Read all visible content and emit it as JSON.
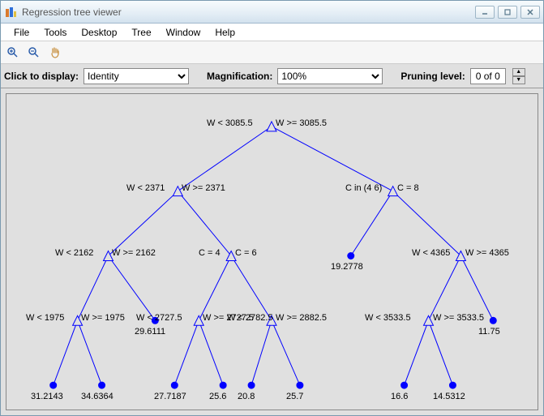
{
  "window": {
    "title": "Regression tree viewer"
  },
  "menu": {
    "file": "File",
    "tools": "Tools",
    "desktop": "Desktop",
    "tree": "Tree",
    "window": "Window",
    "help": "Help"
  },
  "icons": {
    "zoom_in": "zoom-in-icon",
    "zoom_out": "zoom-out-icon",
    "pan": "pan-icon"
  },
  "controls": {
    "click_label": "Click to display:",
    "click_value": "Identity",
    "mag_label": "Magnification:",
    "mag_value": "100%",
    "pruning_label": "Pruning level:",
    "pruning_value": "0 of 0"
  },
  "tree_labels": {
    "n0l": "W < 3085.5",
    "n0r": "W >= 3085.5",
    "n1l": "W < 2371",
    "n1r": "W >= 2371",
    "n2l": "C in (4 6)",
    "n2r": "C = 8",
    "n3l": "W < 2162",
    "n3r": "W >= 2162",
    "n4l": "C = 4",
    "n4r": "C = 6",
    "n5leaf": "19.2778",
    "n6l": "W < 4365",
    "n6r": "W >= 4365",
    "n7l": "W < 1975",
    "n7r": "W >= 1975",
    "n8leaf": "29.6111",
    "n9l": "W < 2727.5",
    "n9r": "W >= 2727.5",
    "n10r": "W >= 2882.5",
    "n11l": "W < 3533.5",
    "n11r": "W >= 3533.5",
    "n12leaf": "11.75",
    "l1": "31.2143",
    "l2": "34.6364",
    "l3": "27.7187",
    "l4": "25.6",
    "l5": "20.8",
    "l6": "25.7",
    "l7": "16.6",
    "l8": "14.5312"
  },
  "n10l_overlap": "W < 2782.5"
}
